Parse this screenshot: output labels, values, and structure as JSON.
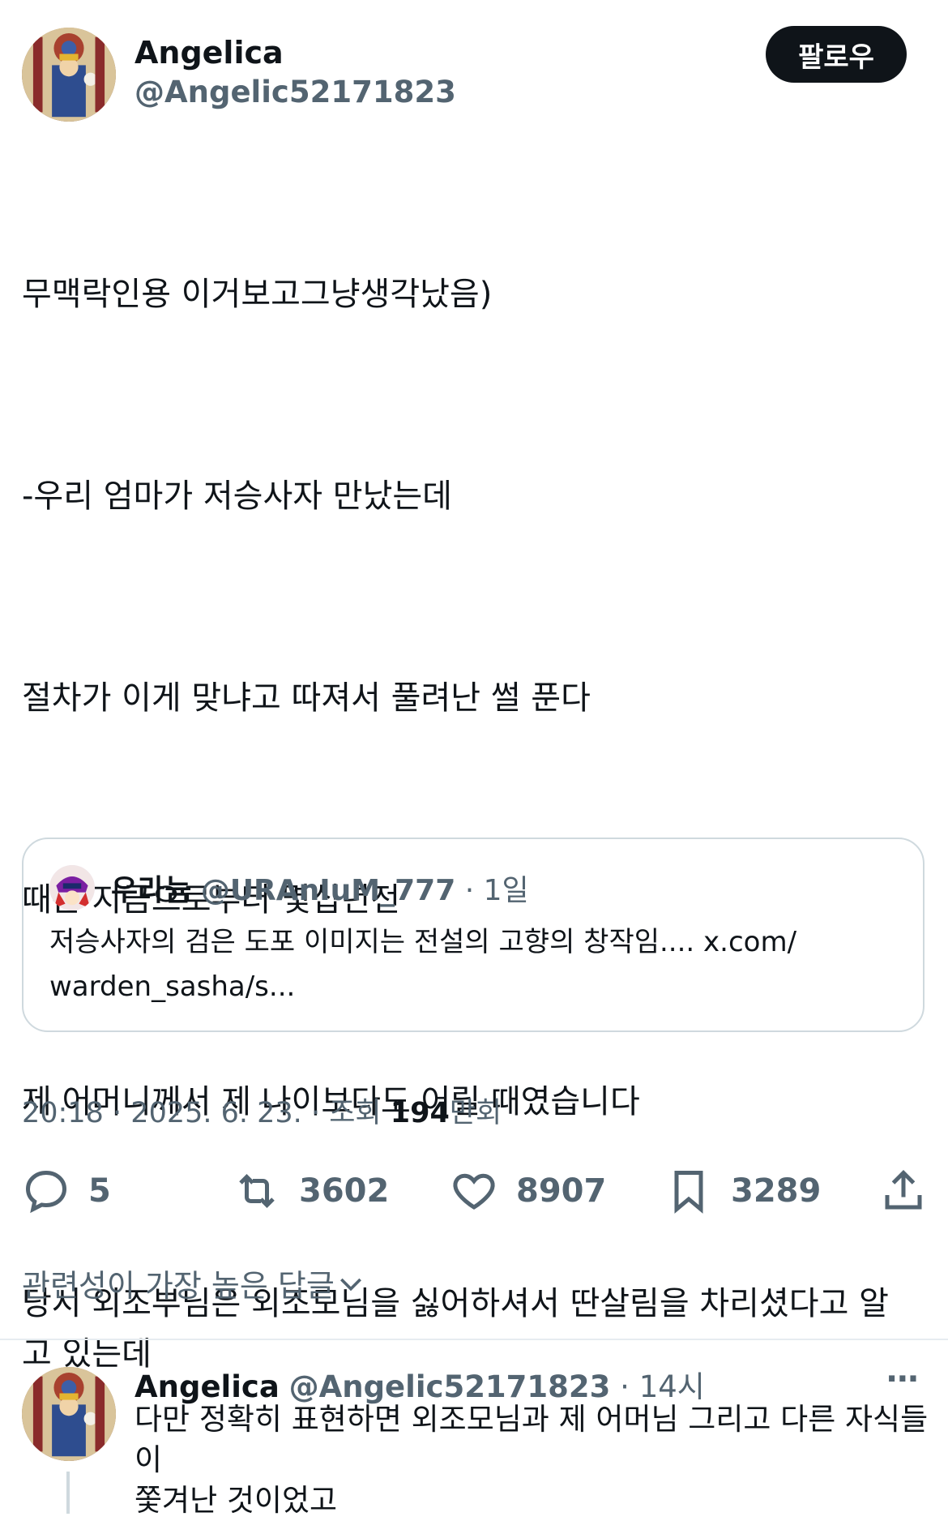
{
  "tweet": {
    "author_name": "Angelica",
    "author_handle": "@Angelic52171823",
    "follow_label": "팔로우",
    "lines": [
      "무맥락인용 이거보고그냥생각났음)",
      "-우리 엄마가 저승사자 만났는데",
      "절차가 이게 맞냐고 따져서 풀려난 썰 푼다",
      "때는 지금으로부터 몇십년전",
      "제 어머니께서 제 나이보다도 어릴 때였습니다",
      "당시 외조부님은 외조모님을 싫어하셔서 딴살림을 차리셨다고 알\n고 있는데"
    ],
    "quote": {
      "name": "우라늄",
      "handle": "@URAnIuM_777",
      "time": "· 1일",
      "text": "저승사자의 검은 도포 이미지는 전설의 고향의 창작임.... x.com/\nwarden_sasha/s..."
    },
    "meta": {
      "time": "20:18",
      "sep1": "·",
      "date": "2025. 6. 23.",
      "sep2": "·",
      "views_label": "조회",
      "views_count": "194",
      "views_unit": "만회"
    },
    "actions": {
      "replies": "5",
      "retweets": "3602",
      "likes": "8907",
      "bookmarks": "3289"
    },
    "sort_label": "관련성이 가장 높은 답글"
  },
  "reply": {
    "author_name": "Angelica",
    "author_handle": "@Angelic52171823",
    "time": "· 14시",
    "more": "···",
    "text": "다만 정확히 표현하면 외조모님과 제 어머님 그리고 다른 자식들이\n쫓겨난 것이었고"
  },
  "colors": {
    "text": "#0f1419",
    "secondary": "#536471",
    "border": "#cfd9de",
    "button_bg": "#0f1419"
  },
  "icons": [
    "reply-icon",
    "retweet-icon",
    "like-icon",
    "bookmark-icon",
    "share-icon",
    "chevron-down-icon",
    "more-icon"
  ]
}
